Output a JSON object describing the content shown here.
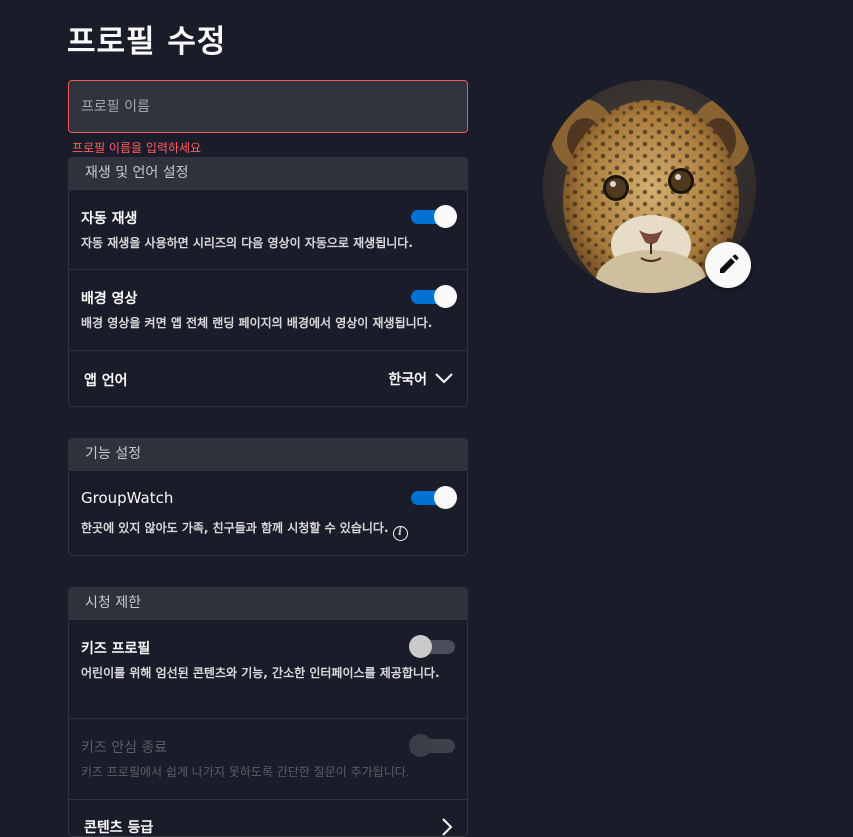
{
  "page": {
    "title": "프로필 수정"
  },
  "name_field": {
    "placeholder": "프로필 이름",
    "value": "",
    "error": "프로필 이름을 입력하세요"
  },
  "playback": {
    "header": "재생 및 언어 설정",
    "autoplay": {
      "title": "자동 재생",
      "desc": "자동 재생을 사용하면 시리즈의 다음 영상이 자동으로 재생됩니다.",
      "on": true
    },
    "background_video": {
      "title": "배경 영상",
      "desc": "배경 영상을 켜면 앱 전체 랜딩 페이지의 배경에서 영상이 재생됩니다.",
      "on": true
    },
    "app_language": {
      "title": "앱 언어",
      "value": "한국어"
    }
  },
  "features": {
    "header": "기능 설정",
    "groupwatch": {
      "title": "GroupWatch",
      "desc": "한곳에 있지 않아도 가족, 친구들과 함께 시청할 수 있습니다.",
      "on": true
    }
  },
  "restrictions": {
    "header": "시청 제한",
    "kids_profile": {
      "title": "키즈 프로필",
      "desc": "어린이를 위해 엄선된 콘텐츠와 기능, 간소한 인터페이스를 제공합니다.",
      "on": false
    },
    "kids_safe_exit": {
      "title": "키즈 안심 종료",
      "desc": "키즈 프로필에서 쉽게 나가지 못하도록 간단한 질문이 추가됩니다.",
      "on": false,
      "disabled": true
    },
    "content_rating": {
      "title": "콘텐츠 등급"
    }
  },
  "colors": {
    "background": "#1a1c29",
    "accent": "#0072d2",
    "error": "#ff6161"
  },
  "icons": {
    "edit": "pencil-icon",
    "info": "info-icon",
    "dropdown": "chevron-down-icon",
    "next": "chevron-right-icon"
  }
}
